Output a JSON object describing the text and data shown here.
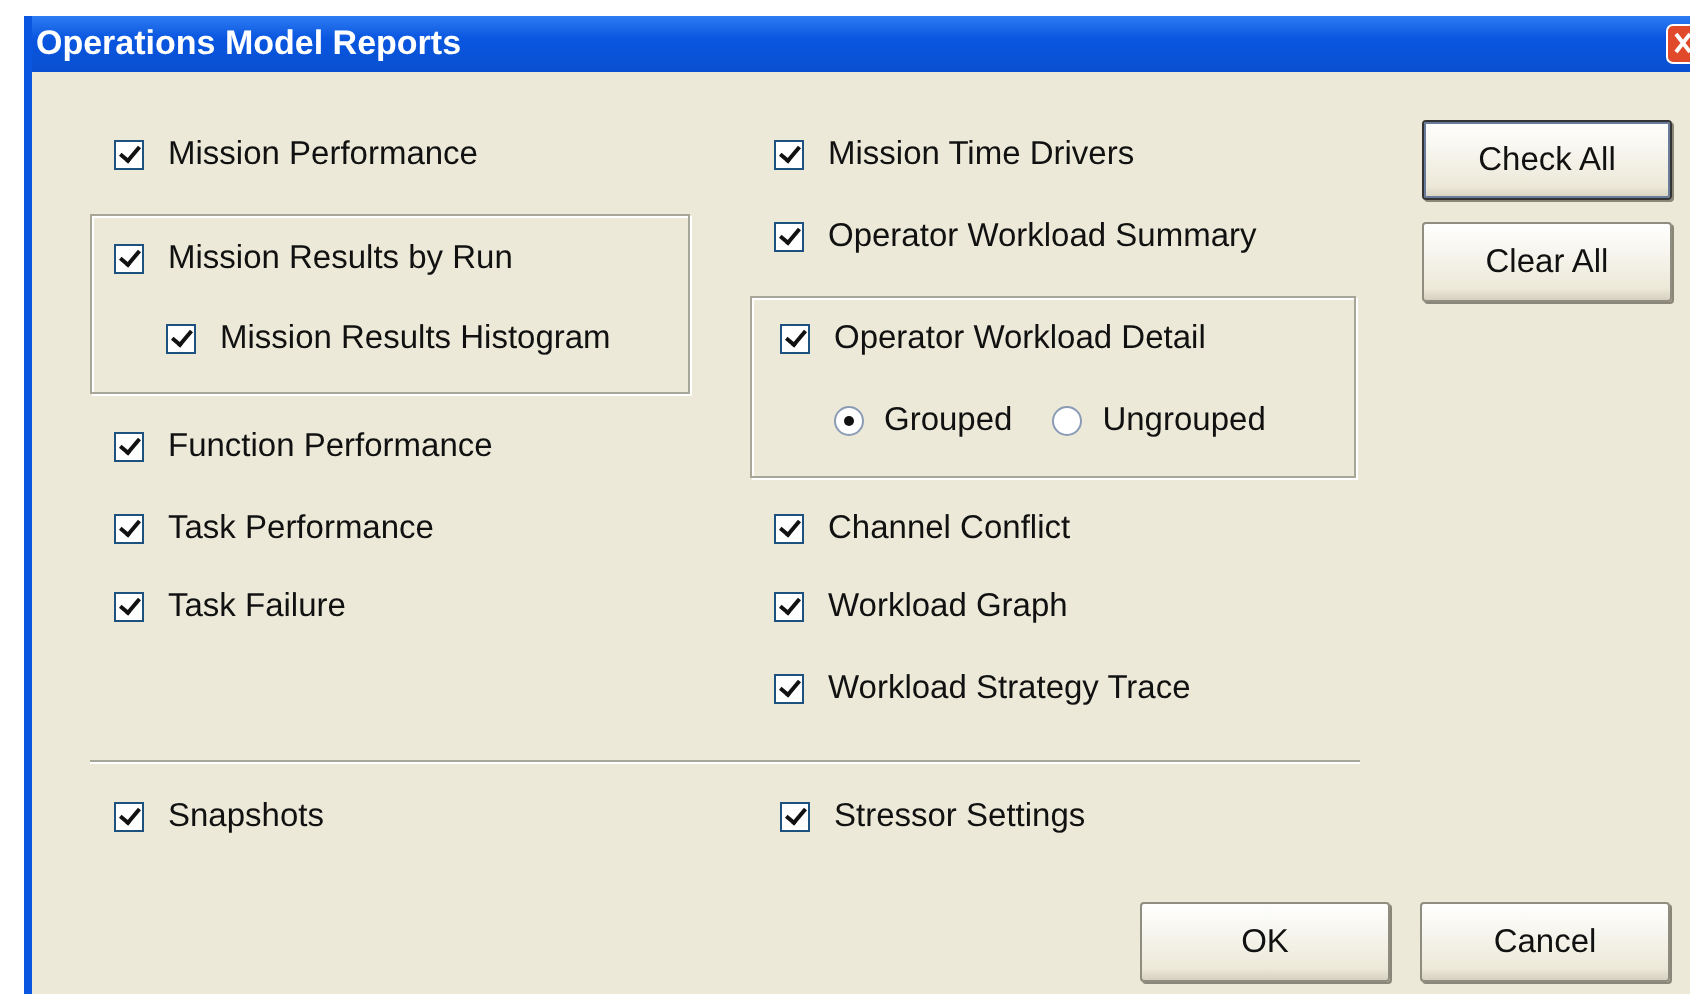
{
  "window": {
    "title": "Operations Model Reports"
  },
  "left": [
    {
      "kind": "checkbox",
      "label": "Mission Performance",
      "checked": true
    },
    {
      "kind": "group",
      "label": "Mission Results by Run",
      "checked": true,
      "children": [
        {
          "label": "Mission Results Histogram",
          "checked": true
        }
      ]
    },
    {
      "kind": "checkbox",
      "label": "Function Performance",
      "checked": true
    },
    {
      "kind": "checkbox",
      "label": "Task Performance",
      "checked": true
    },
    {
      "kind": "checkbox",
      "label": "Task Failure",
      "checked": true
    }
  ],
  "right": [
    {
      "kind": "checkbox",
      "label": "Mission Time Drivers",
      "checked": true
    },
    {
      "kind": "checkbox",
      "label": "Operator Workload Summary",
      "checked": true
    },
    {
      "kind": "group",
      "label": "Operator Workload Detail",
      "checked": true,
      "options": [
        {
          "label": "Grouped",
          "selected": true
        },
        {
          "label": "Ungrouped",
          "selected": false
        }
      ]
    },
    {
      "kind": "checkbox",
      "label": "Channel Conflict",
      "checked": true
    },
    {
      "kind": "checkbox",
      "label": "Workload Graph",
      "checked": true
    },
    {
      "kind": "checkbox",
      "label": "Workload Strategy Trace",
      "checked": true
    }
  ],
  "side_buttons": [
    {
      "label": "Check All",
      "default": true
    },
    {
      "label": "Clear All",
      "default": false
    }
  ],
  "bottom": [
    {
      "label": "Snapshots",
      "checked": true
    },
    {
      "label": "Stressor Settings",
      "checked": true
    }
  ],
  "buttons": [
    {
      "label": "OK",
      "default": false
    },
    {
      "label": "Cancel",
      "default": false
    }
  ]
}
